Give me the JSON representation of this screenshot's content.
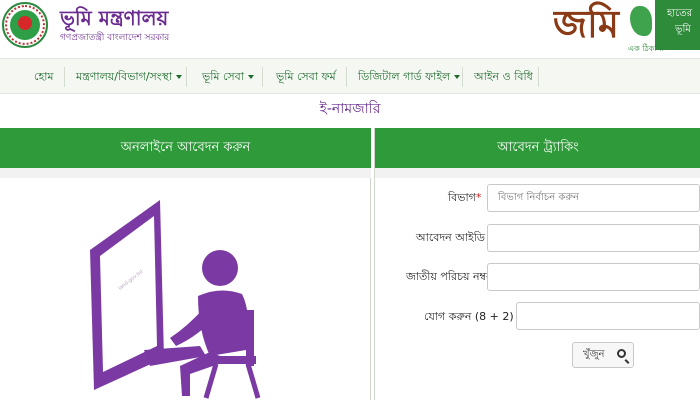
{
  "header": {
    "ministry_title": "ভূমি মন্ত্রণালয়",
    "ministry_subtitle": "গণপ্রজাতন্ত্রী বাংলাদেশ সরকার",
    "brand_name": "জমি",
    "brand_side_line1": "হাতের",
    "brand_side_line2": "ভূমি",
    "brand_tagline": "এক ঠিকানা"
  },
  "nav": {
    "items": [
      {
        "label": "হোম",
        "dropdown": false
      },
      {
        "label": "মন্ত্রণালয়/বিভাগ/সংস্থা",
        "dropdown": true
      },
      {
        "label": "ভূমি সেবা",
        "dropdown": true
      },
      {
        "label": "ভূমি সেবা ফর্ম",
        "dropdown": false
      },
      {
        "label": "ডিজিটাল গার্ড ফাইল",
        "dropdown": true
      },
      {
        "label": "আইন ও বিধি",
        "dropdown": false
      }
    ]
  },
  "page": {
    "subtitle": "ই-নামজারি"
  },
  "left_panel": {
    "title": "অনলাইনে আবেদন করুন",
    "screen_text": "land.gov.bd"
  },
  "right_panel": {
    "title": "আবেদন ট্র্যাকিং",
    "division_label": "বিভাগ",
    "division_placeholder": "বিভাগ নির্বাচন করুন",
    "application_id_label": "আবেদন আইডি",
    "nid_label": "জাতীয় পরিচয় নম্বর",
    "captcha_label": "যোগ করুন (8 + 2) =",
    "required_mark": "*",
    "search_label": "খুঁজুন"
  },
  "colors": {
    "brand_green": "#2f9a3a",
    "brand_purple": "#6b2c91",
    "illustration_purple": "#7b3aa3"
  },
  "icons": [
    "search-icon",
    "caret-down-icon",
    "government-seal-logo"
  ]
}
